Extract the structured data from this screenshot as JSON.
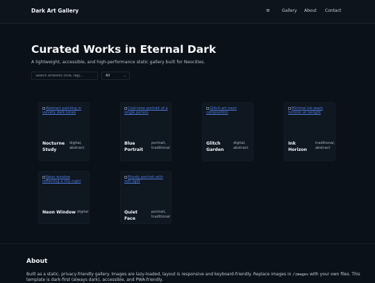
{
  "header": {
    "brand": "Dark Art Gallery",
    "menu_icon": "≡",
    "nav": [
      "Gallery",
      "About",
      "Contact"
    ]
  },
  "hero": {
    "title": "Curated Works in Eternal Dark",
    "subtitle": "A lightweight, accessible, and high-performance static gallery built for Neocities."
  },
  "controls": {
    "search_placeholder": "Search artworks (title, tag)...",
    "filter_value": "All"
  },
  "gallery": [
    {
      "alt": "Abstract painting in velvety dark tones",
      "title": "Nocturne Study",
      "tags": "digital, abstract"
    },
    {
      "alt": "Cool-tone portrait of a single person",
      "title": "Blue Portrait",
      "tags": "portrait, traditional"
    },
    {
      "alt": "Glitch-art neon composition",
      "title": "Glitch Garden",
      "tags": "digital, abstract"
    },
    {
      "alt": "Minimal ink-wash horizon at twilight",
      "title": "Ink Horizon",
      "tags": "traditional, abstract"
    },
    {
      "alt": "Neon window reflecting a city night",
      "title": "Neon Window",
      "tags": "digital"
    },
    {
      "alt": "Moody portrait with soft light",
      "title": "Quiet Face",
      "tags": "portrait, traditional"
    }
  ],
  "about": {
    "title": "About",
    "text_before": "Built as a static, privacy-friendly gallery. Images are lazy-loaded, layout is responsive and keyboard-friendly. Replace images in ",
    "code": "/images",
    "text_after": " with your own files. This template is dark-first (always dark), accessible, and PWA-friendly."
  },
  "colors": {
    "background": "#0b1118",
    "card": "#0f1720",
    "link": "#4f7ce0"
  }
}
